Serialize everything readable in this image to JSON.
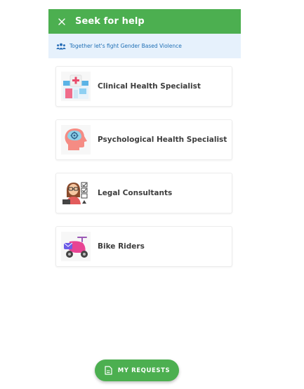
{
  "header": {
    "title": "Seek for help",
    "close_icon": "close-icon",
    "background": "#4caf50"
  },
  "banner": {
    "text": "Together let's fight Gender Based Violence",
    "icon": "people-group-icon",
    "background": "#e6f1fc",
    "text_color": "#1f6fb5"
  },
  "services": [
    {
      "label": "Clinical Health Specialist",
      "icon": "hospital-icon"
    },
    {
      "label": "Psychological Health Specialist",
      "icon": "brain-head-icon"
    },
    {
      "label": "Legal Consultants",
      "icon": "legal-consultant-icon"
    },
    {
      "label": "Bike Riders",
      "icon": "delivery-scooter-icon"
    }
  ],
  "fab": {
    "label": "MY REQUESTS",
    "icon": "document-icon",
    "background": "#4caf50"
  }
}
